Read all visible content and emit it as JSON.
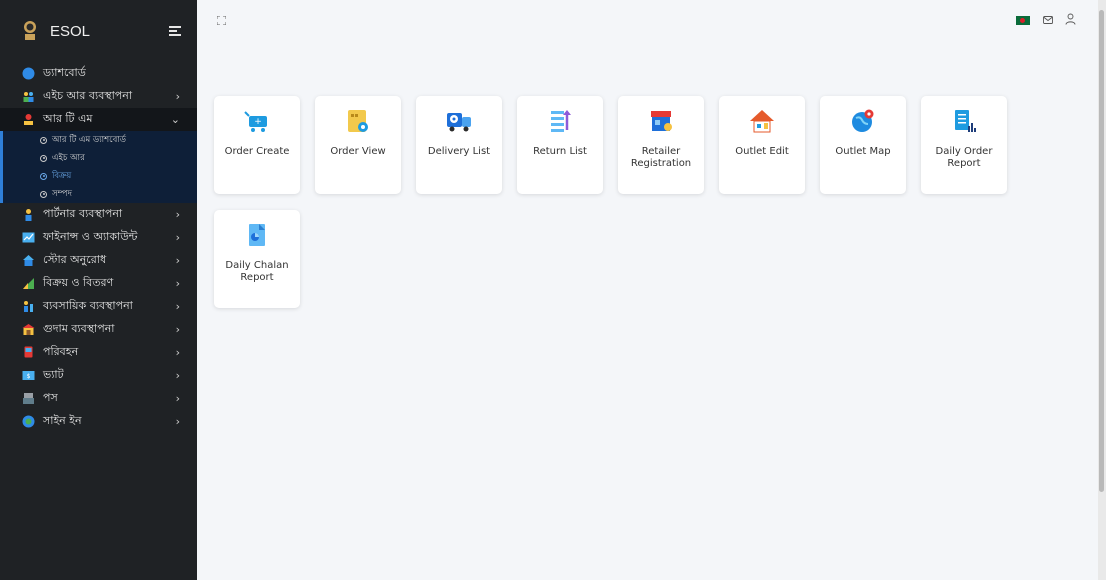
{
  "sidebar": {
    "brand": "ESOL",
    "items": [
      {
        "label": "ড্যাশবোর্ড",
        "icon": "dashboard-icon"
      },
      {
        "label": "এইচ আর ব্যবস্থাপনা",
        "icon": "hr-people-icon"
      },
      {
        "label": "আর টি এম",
        "icon": "rtm-icon"
      },
      {
        "label": "পার্টনার ব্যবস্থাপনা",
        "icon": "partner-icon"
      },
      {
        "label": "ফাইনান্স ও অ্যাকাউন্ট",
        "icon": "finance-icon"
      },
      {
        "label": "স্টোর অনুরোধ",
        "icon": "store-icon"
      },
      {
        "label": "বিক্রয় ও বিতরণ",
        "icon": "sales-icon"
      },
      {
        "label": "ব্যবসায়িক ব্যবস্থাপনা",
        "icon": "business-icon"
      },
      {
        "label": "গুদাম ব্যবস্থাপনা",
        "icon": "warehouse-icon"
      },
      {
        "label": "পরিবহন",
        "icon": "transport-icon"
      },
      {
        "label": "ভ্যাট",
        "icon": "vat-icon"
      },
      {
        "label": "পস",
        "icon": "pos-icon"
      },
      {
        "label": "সাইন ইন",
        "icon": "sign-in-icon"
      }
    ],
    "rtm_submenu": [
      {
        "label": "আর টি এম ড্যাশবোর্ড"
      },
      {
        "label": "এইচ আর"
      },
      {
        "label": "বিক্রয়"
      },
      {
        "label": "সম্পদ"
      }
    ]
  },
  "tiles": [
    {
      "label": "Order Create",
      "icon": "cart-icon"
    },
    {
      "label": "Order View",
      "icon": "order-view-icon"
    },
    {
      "label": "Delivery List",
      "icon": "delivery-truck-icon"
    },
    {
      "label": "Return List",
      "icon": "return-list-icon"
    },
    {
      "label": "Retailer Registration",
      "icon": "retailer-shop-icon"
    },
    {
      "label": "Outlet Edit",
      "icon": "outlet-edit-icon"
    },
    {
      "label": "Outlet Map",
      "icon": "outlet-map-icon"
    },
    {
      "label": "Daily Order Report",
      "icon": "daily-order-report-icon"
    },
    {
      "label": "Daily Chalan Report",
      "icon": "daily-chalan-report-icon"
    }
  ],
  "colors": {
    "sidebar_bg": "#1f2225",
    "submenu_bg": "#0e1f38",
    "accent": "#2f7fd8",
    "page_bg": "#f4f6f9"
  }
}
